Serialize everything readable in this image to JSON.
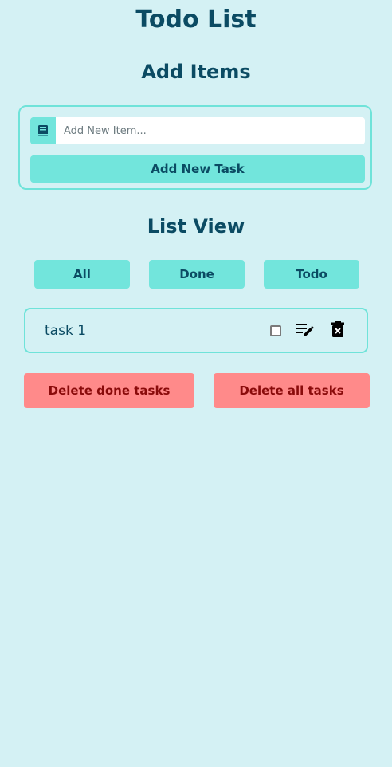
{
  "page": {
    "title": "Todo List",
    "add_heading": "Add Items",
    "list_heading": "List View"
  },
  "add_form": {
    "icon": "book-icon",
    "input_value": "",
    "input_placeholder": "Add New Item...",
    "submit_label": "Add New Task"
  },
  "filters": [
    {
      "label": "All"
    },
    {
      "label": "Done"
    },
    {
      "label": "Todo"
    }
  ],
  "tasks": [
    {
      "label": "task 1",
      "done": false
    }
  ],
  "actions": {
    "delete_done_label": "Delete done tasks",
    "delete_all_label": "Delete all tasks"
  },
  "colors": {
    "background": "#d4f1f4",
    "accent": "#72e5dc",
    "heading": "#0b4b63",
    "danger": "#ff8a8a",
    "danger_text": "#8a0b0b"
  }
}
